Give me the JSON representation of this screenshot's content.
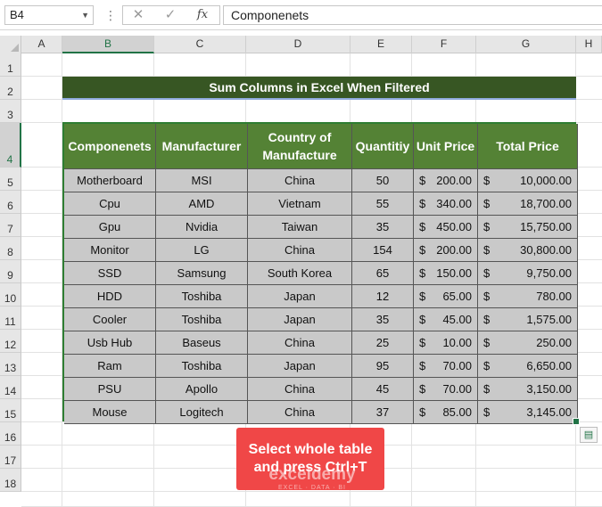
{
  "formula_bar": {
    "name_box": "B4",
    "cancel_glyph": "✕",
    "enter_glyph": "✓",
    "fx_label": "fx",
    "content": "Componenets"
  },
  "columns": [
    "A",
    "B",
    "C",
    "D",
    "E",
    "F",
    "G",
    "H"
  ],
  "rows": [
    "1",
    "2",
    "3",
    "4",
    "5",
    "6",
    "7",
    "8",
    "9",
    "10",
    "11",
    "12",
    "13",
    "14",
    "15",
    "16",
    "17",
    "18"
  ],
  "selected_cell": {
    "column": "B",
    "row": "4"
  },
  "title": "Sum  Columns in Excel When Filtered",
  "table": {
    "headers": [
      "Componenets",
      "Manufacturer",
      "Country of Manufacture",
      "Quantity",
      "Unit Price",
      "Total Price"
    ],
    "header_display": [
      "Componenets",
      "Manufacturer",
      "Country of Manufacture",
      "Quantitiy",
      "Unit Price",
      "Total Price"
    ],
    "currency_symbol": "$",
    "rows": [
      [
        "Motherboard",
        "MSI",
        "China",
        "50",
        "200.00",
        "10,000.00"
      ],
      [
        "Cpu",
        "AMD",
        "Vietnam",
        "55",
        "340.00",
        "18,700.00"
      ],
      [
        "Gpu",
        "Nvidia",
        "Taiwan",
        "35",
        "450.00",
        "15,750.00"
      ],
      [
        "Monitor",
        "LG",
        "China",
        "154",
        "200.00",
        "30,800.00"
      ],
      [
        "SSD",
        "Samsung",
        "South Korea",
        "65",
        "150.00",
        "9,750.00"
      ],
      [
        "HDD",
        "Toshiba",
        "Japan",
        "12",
        "65.00",
        "780.00"
      ],
      [
        "Cooler",
        "Toshiba",
        "Japan",
        "35",
        "45.00",
        "1,575.00"
      ],
      [
        "Usb Hub",
        "Baseus",
        "China",
        "25",
        "10.00",
        "250.00"
      ],
      [
        "Ram",
        "Toshiba",
        "Japan",
        "95",
        "70.00",
        "6,650.00"
      ],
      [
        "PSU",
        "Apollo",
        "China",
        "45",
        "70.00",
        "3,150.00"
      ],
      [
        "Mouse",
        "Logitech",
        "China",
        "37",
        "85.00",
        "3,145.00"
      ]
    ]
  },
  "callout": {
    "line1": "Select whole table",
    "line2": "and press Ctrl+T"
  },
  "watermark": {
    "brand": "exceldemy",
    "tagline": "EXCEL · DATA · BI"
  },
  "colors": {
    "title_bg": "#375623",
    "header_bg": "#548235",
    "cell_bg": "#c9c9c9",
    "callout_bg": "#f04747",
    "excel_green": "#217346"
  }
}
